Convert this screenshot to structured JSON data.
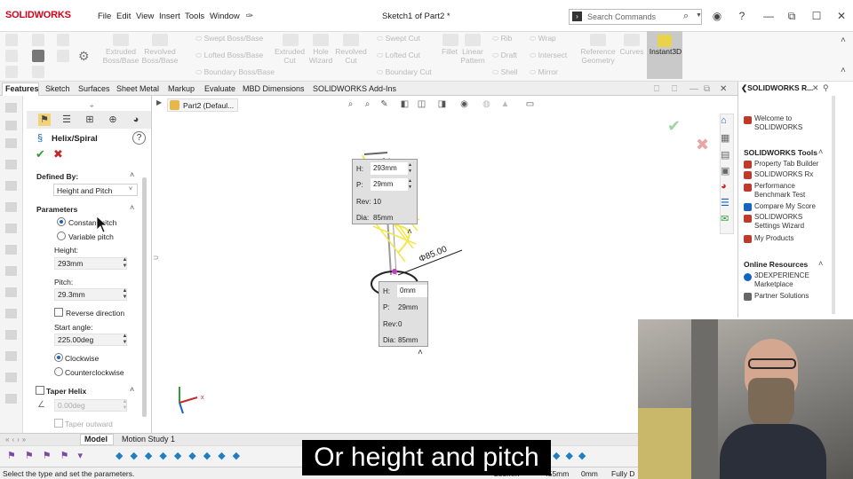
{
  "app": {
    "logo_text": "SOLIDWORKS",
    "menu": [
      "File",
      "Edit",
      "View",
      "Insert",
      "Tools",
      "Window"
    ],
    "document_title": "Sketch1 of Part2 *",
    "search_placeholder": "Search Commands"
  },
  "command_manager": {
    "features": [
      {
        "label": "Extruded Boss/Base",
        "icon": "extrude-boss-icon"
      },
      {
        "label": "Revolved Boss/Base",
        "icon": "revolve-boss-icon"
      },
      {
        "label": "Extruded Cut",
        "icon": "extrude-cut-icon"
      },
      {
        "label": "Hole Wizard",
        "icon": "hole-wizard-icon"
      },
      {
        "label": "Revolved Cut",
        "icon": "revolve-cut-icon"
      },
      {
        "label": "Fillet",
        "icon": "fillet-icon"
      },
      {
        "label": "Linear Pattern",
        "icon": "linear-pattern-icon"
      },
      {
        "label": "Reference Geometry",
        "icon": "reference-geometry-icon"
      },
      {
        "label": "Curves",
        "icon": "curves-icon"
      },
      {
        "label": "Instant3D",
        "icon": "instant3d-icon"
      }
    ],
    "small_group1": [
      "Swept Boss/Base",
      "Lofted Boss/Base",
      "Boundary Boss/Base"
    ],
    "small_group2": [
      "Swept Cut",
      "Lofted Cut",
      "Boundary Cut"
    ],
    "small_group3": [
      "Rib",
      "Draft",
      "Shell"
    ],
    "small_group4": [
      "Wrap",
      "Intersect",
      "Mirror"
    ]
  },
  "tabs": [
    "Features",
    "Sketch",
    "Surfaces",
    "Sheet Metal",
    "Markup",
    "Evaluate",
    "MBD Dimensions",
    "SOLIDWORKS Add-Ins"
  ],
  "feature_tree": {
    "root_label": "Part2 (Defaul..."
  },
  "property_manager": {
    "title": "Helix/Spiral",
    "defined_by_label": "Defined By:",
    "defined_by_value": "Height and Pitch",
    "parameters_label": "Parameters",
    "radio_constant": "Constant pitch",
    "radio_variable": "Variable pitch",
    "height_label": "Height:",
    "height_value": "293mm",
    "pitch_label": "Pitch:",
    "pitch_value": "29.3mm",
    "reverse_label": "Reverse direction",
    "start_angle_label": "Start angle:",
    "start_angle_value": "225.00deg",
    "clockwise_label": "Clockwise",
    "counterclockwise_label": "Counterclockwise",
    "taper_label": "Taper Helix",
    "taper_value": "0.00deg",
    "taper_outward_label": "Taper outward"
  },
  "callouts": {
    "top": {
      "h_label": "H:",
      "h": "293mm",
      "p_label": "P:",
      "p": "29mm",
      "rev_label": "Rev:",
      "rev": "10",
      "dia_label": "Dia:",
      "dia": "85mm"
    },
    "bottom": {
      "h_label": "H:",
      "h": "0mm",
      "p_label": "P:",
      "p": "29mm",
      "rev_label": "Rev:",
      "rev": "0",
      "dia_label": "Dia:",
      "dia": "85mm"
    },
    "diameter_dim": "Φ85.00"
  },
  "task_pane": {
    "header": "SOLIDWORKS R...",
    "welcome": "Welcome to SOLIDWORKS",
    "tools_header": "SOLIDWORKS Tools",
    "tools": [
      "Property Tab Builder",
      "SOLIDWORKS Rx",
      "Performance Benchmark Test",
      "Compare My Score",
      "SOLIDWORKS Settings Wizard",
      "My Products"
    ],
    "online_header": "Online Resources",
    "online": [
      "3DEXPERIENCE Marketplace",
      "Partner Solutions"
    ]
  },
  "bottom_tabs": [
    "Model",
    "Motion Study 1"
  ],
  "status": {
    "hint": "Select the type and set the parameters.",
    "x": "285mm",
    "y": "455mm",
    "z": "0mm",
    "state": "Fully D"
  },
  "caption": "Or height and pitch",
  "colors": {
    "accent_blue": "#1565c0",
    "helix_yellow": "#f2e64a",
    "confirm_green": "#2e9e3a",
    "cancel_red": "#c62828",
    "logo_red": "#d0021b"
  }
}
